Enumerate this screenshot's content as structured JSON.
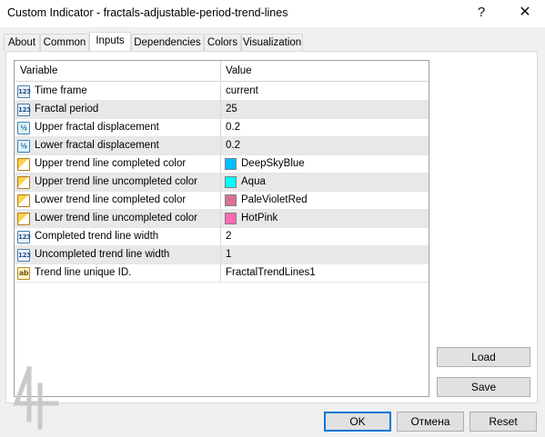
{
  "window": {
    "title": "Custom Indicator - fractals-adjustable-period-trend-lines",
    "help_glyph": "?",
    "close_glyph": "✕"
  },
  "tabs": [
    {
      "label": "About"
    },
    {
      "label": "Common"
    },
    {
      "label": "Inputs"
    },
    {
      "label": "Dependencies"
    },
    {
      "label": "Colors"
    },
    {
      "label": "Visualization"
    }
  ],
  "grid": {
    "header": {
      "variable": "Variable",
      "value": "Value"
    },
    "rows": [
      {
        "icon": "int-icon",
        "icon_text": "123",
        "name": "Time frame",
        "value": "current"
      },
      {
        "icon": "int-icon",
        "icon_text": "123",
        "name": "Fractal period",
        "value": "25"
      },
      {
        "icon": "double-icon",
        "icon_text": "½",
        "name": "Upper fractal displacement",
        "value": "0.2"
      },
      {
        "icon": "double-icon",
        "icon_text": "½",
        "name": "Lower fractal displacement",
        "value": "0.2"
      },
      {
        "icon": "color-icon",
        "icon_text": "",
        "name": "Upper trend line completed color",
        "value": "DeepSkyBlue",
        "swatch": "#00bfff"
      },
      {
        "icon": "color-icon",
        "icon_text": "",
        "name": "Upper trend line uncompleted color",
        "value": "Aqua",
        "swatch": "#00ffff"
      },
      {
        "icon": "color-icon",
        "icon_text": "",
        "name": "Lower trend line completed color",
        "value": "PaleVioletRed",
        "swatch": "#db7093"
      },
      {
        "icon": "color-icon",
        "icon_text": "",
        "name": "Lower trend line uncompleted color",
        "value": "HotPink",
        "swatch": "#ff69b4"
      },
      {
        "icon": "int-icon",
        "icon_text": "123",
        "name": "Completed trend line width",
        "value": "2"
      },
      {
        "icon": "int-icon",
        "icon_text": "123",
        "name": "Uncompleted trend line width",
        "value": "1"
      },
      {
        "icon": "string-icon",
        "icon_text": "ab",
        "name": "Trend line unique ID.",
        "value": "FractalTrendLines1"
      }
    ]
  },
  "side_buttons": {
    "load": "Load",
    "save": "Save"
  },
  "footer_buttons": {
    "ok": "OK",
    "cancel": "Отмена",
    "reset": "Reset"
  },
  "colors": {
    "accent": "#0078d7",
    "selected_tab_bg": "#ffffff"
  }
}
